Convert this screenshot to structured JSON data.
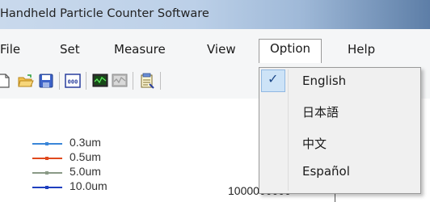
{
  "window": {
    "title": "Handheld Particle Counter Software"
  },
  "menubar": {
    "items": [
      {
        "label": "File"
      },
      {
        "label": "Set"
      },
      {
        "label": "Measure"
      },
      {
        "label": "View"
      },
      {
        "label": "Option"
      },
      {
        "label": "Help"
      }
    ]
  },
  "toolbar": {
    "buttons": [
      "new-file-icon",
      "open-folder-icon",
      "save-icon",
      "counter-display-icon",
      "monitor-icon",
      "monitor-disabled-icon",
      "report-icon"
    ]
  },
  "option_menu": {
    "items": [
      {
        "label": "English",
        "checked": true
      },
      {
        "label": "日本語",
        "checked": false
      },
      {
        "label": "中文",
        "checked": false
      },
      {
        "label": "Español",
        "checked": false
      }
    ],
    "check_glyph": "✓"
  },
  "legend": {
    "items": [
      {
        "label": "0.3um",
        "color": "#3a86d8"
      },
      {
        "label": "0.5um",
        "color": "#e04a1e"
      },
      {
        "label": "5.0um",
        "color": "#8a9a86"
      },
      {
        "label": "10.0um",
        "color": "#1f3fbf"
      }
    ]
  },
  "plot": {
    "y_tick_label": "1000000000"
  }
}
